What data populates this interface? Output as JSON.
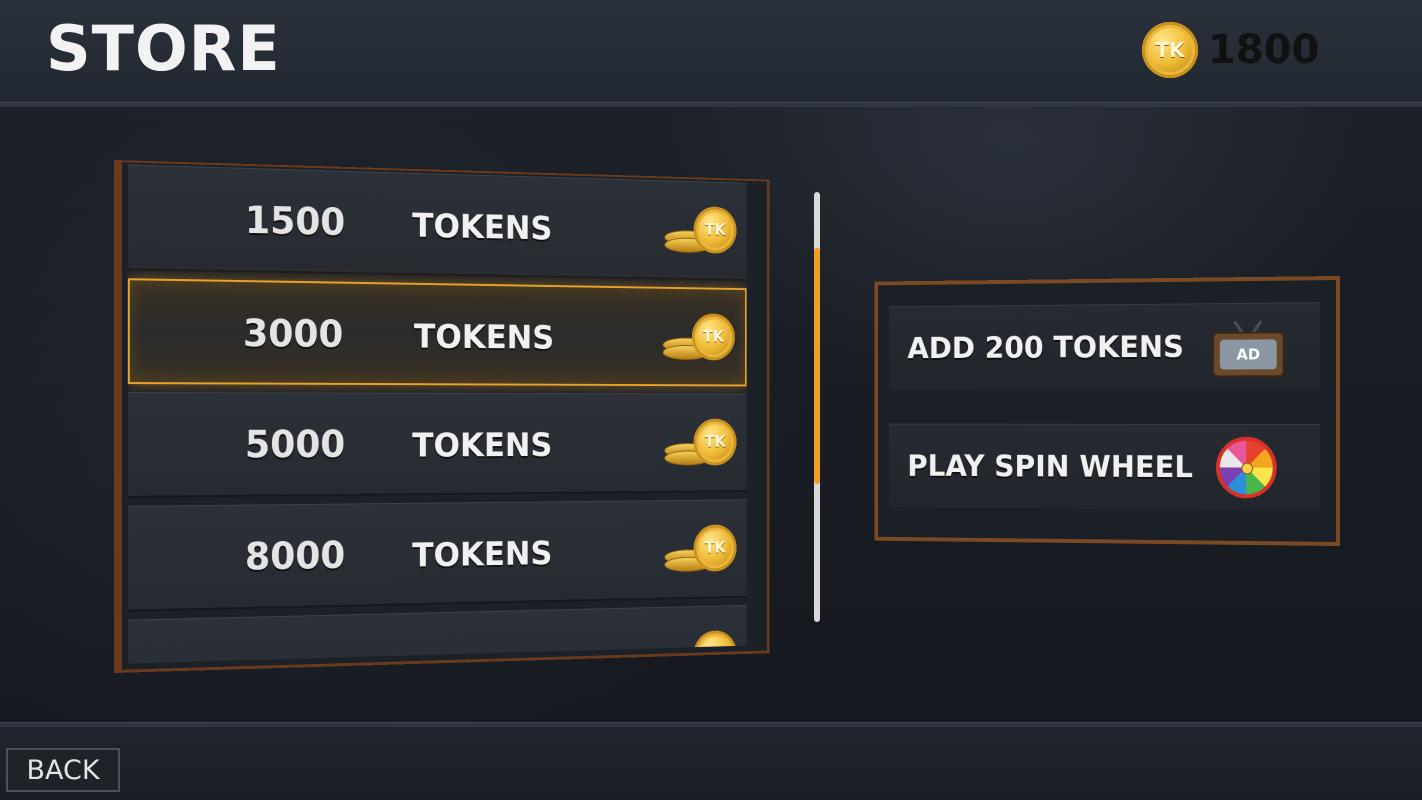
{
  "header": {
    "title": "STORE",
    "balance": "1800",
    "coin_label": "TK",
    "coin_icon": "gold-token-coin-icon"
  },
  "token_packs": [
    {
      "amount": "1500",
      "label": "TOKENS",
      "selected": false
    },
    {
      "amount": "3000",
      "label": "TOKENS",
      "selected": true
    },
    {
      "amount": "5000",
      "label": "TOKENS",
      "selected": false
    },
    {
      "amount": "8000",
      "label": "TOKENS",
      "selected": false
    },
    {
      "amount": "",
      "label": "",
      "selected": false
    }
  ],
  "free_tokens": {
    "ad": {
      "label": "ADD 200 TOKENS",
      "icon": "tv-ad-icon",
      "icon_text": "AD"
    },
    "spin": {
      "label": "PLAY SPIN WHEEL",
      "icon": "spin-wheel-icon"
    }
  },
  "footer": {
    "back_label": "BACK"
  },
  "colors": {
    "accent": "#f0a020",
    "frame": "#7b4a22",
    "coin": "#f1bd37"
  }
}
